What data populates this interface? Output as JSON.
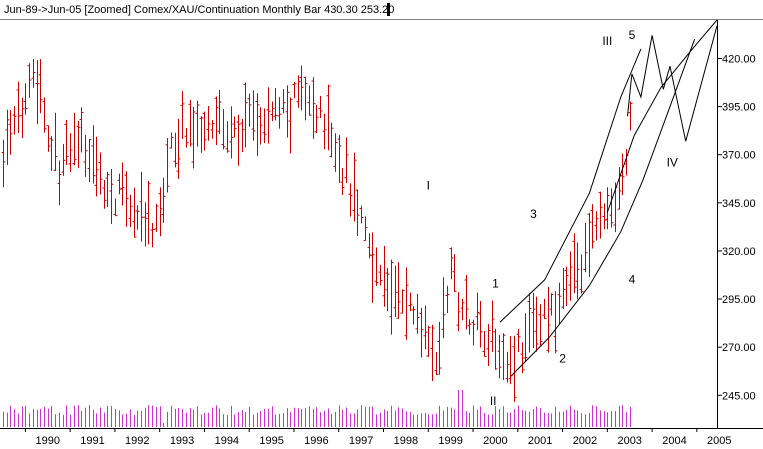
{
  "header": {
    "title": "Jun-89->Jun-05 [Zoomed] Comex/XAU/Continuation Monthly Bar 430.30 253.20"
  },
  "colors": {
    "background": "#ffffff",
    "price_bars": "#cc0000",
    "volume_bars": "#cc33cc",
    "projection_lines": "#000000",
    "axis": "#000000"
  },
  "chart_data": {
    "type": "bar",
    "subtype": "ohlc-monthly",
    "title": "Jun-89->Jun-05 [Zoomed] Comex/XAU/Continuation Monthly Bar 430.30 253.20",
    "x_start": 1989.5,
    "x_end": 2005.5,
    "xlim": [
      1989.5,
      2005.45
    ],
    "ylim": [
      228,
      440
    ],
    "x_ticks": [
      "1990",
      "1991",
      "1992",
      "1993",
      "1994",
      "1995",
      "1996",
      "1997",
      "1998",
      "1999",
      "2000",
      "2001",
      "2002",
      "2003",
      "2004",
      "2005"
    ],
    "y_ticks": [
      "420.00",
      "395.00",
      "370.00",
      "345.00",
      "320.00",
      "295.00",
      "270.00",
      "245.00"
    ],
    "y_tick_values": [
      420,
      395,
      370,
      345,
      320,
      295,
      270,
      245
    ],
    "grid": false,
    "legend": "none",
    "price_anchors": [
      [
        1989.5,
        372
      ],
      [
        1989.9,
        392
      ],
      [
        1990.1,
        418
      ],
      [
        1990.35,
        402
      ],
      [
        1990.6,
        372
      ],
      [
        1990.8,
        362
      ],
      [
        1991.2,
        378
      ],
      [
        1991.6,
        360
      ],
      [
        1991.9,
        350
      ],
      [
        1992.2,
        348
      ],
      [
        1992.5,
        340
      ],
      [
        1992.8,
        330
      ],
      [
        1993.0,
        338
      ],
      [
        1993.25,
        372
      ],
      [
        1993.5,
        385
      ],
      [
        1993.8,
        380
      ],
      [
        1994.1,
        392
      ],
      [
        1994.4,
        385
      ],
      [
        1994.7,
        378
      ],
      [
        1995.0,
        388
      ],
      [
        1995.3,
        384
      ],
      [
        1995.6,
        395
      ],
      [
        1995.9,
        390
      ],
      [
        1996.1,
        404
      ],
      [
        1996.4,
        395
      ],
      [
        1996.7,
        388
      ],
      [
        1997.0,
        370
      ],
      [
        1997.3,
        350
      ],
      [
        1997.6,
        330
      ],
      [
        1997.9,
        308
      ],
      [
        1998.2,
        298
      ],
      [
        1998.5,
        292
      ],
      [
        1998.8,
        285
      ],
      [
        1999.0,
        280
      ],
      [
        1999.2,
        262
      ],
      [
        1999.35,
        290
      ],
      [
        1999.5,
        310
      ],
      [
        1999.7,
        292
      ],
      [
        2000.0,
        285
      ],
      [
        2000.3,
        278
      ],
      [
        2000.6,
        272
      ],
      [
        2000.85,
        262
      ],
      [
        2001.0,
        268
      ],
      [
        2001.2,
        275
      ],
      [
        2001.45,
        285
      ],
      [
        2001.7,
        285
      ],
      [
        2001.9,
        292
      ],
      [
        2002.1,
        303
      ],
      [
        2002.35,
        315
      ],
      [
        2002.6,
        320
      ],
      [
        2002.8,
        340
      ],
      [
        2003.0,
        335
      ],
      [
        2003.15,
        345
      ],
      [
        2003.3,
        355
      ],
      [
        2003.45,
        370
      ],
      [
        2003.5,
        385
      ]
    ],
    "volume_level": "low, roughly uniform with a spike in 1999",
    "annotations": {
      "wave_labels": [
        {
          "text": "III",
          "x": 2003.0,
          "y": 427
        },
        {
          "text": "5",
          "x": 2003.55,
          "y": 430
        },
        {
          "text": "I",
          "x": 1999.0,
          "y": 352
        },
        {
          "text": "3",
          "x": 2001.35,
          "y": 337
        },
        {
          "text": "1",
          "x": 2000.5,
          "y": 301
        },
        {
          "text": "4",
          "x": 2003.55,
          "y": 303
        },
        {
          "text": "IV",
          "x": 2004.45,
          "y": 364
        },
        {
          "text": "2",
          "x": 2002.0,
          "y": 262
        },
        {
          "text": "II",
          "x": 2000.45,
          "y": 240
        }
      ],
      "channel_upper": [
        [
          2000.6,
          283
        ],
        [
          2001.6,
          305
        ],
        [
          2002.6,
          350
        ],
        [
          2003.3,
          400
        ],
        [
          2003.75,
          425
        ]
      ],
      "channel_lower": [
        [
          2000.85,
          255
        ],
        [
          2001.7,
          275
        ],
        [
          2002.6,
          302
        ],
        [
          2003.3,
          330
        ],
        [
          2003.8,
          357
        ],
        [
          2004.4,
          395
        ],
        [
          2004.95,
          430
        ]
      ],
      "channel_outer": [
        [
          2003.0,
          340
        ],
        [
          2003.6,
          380
        ],
        [
          2004.2,
          405
        ],
        [
          2004.9,
          425
        ],
        [
          2005.45,
          440
        ]
      ],
      "zigzag_projection": [
        [
          2003.45,
          390
        ],
        [
          2003.55,
          412
        ],
        [
          2003.75,
          400
        ],
        [
          2004.0,
          432
        ],
        [
          2004.25,
          404
        ],
        [
          2004.4,
          416
        ],
        [
          2004.75,
          377
        ],
        [
          2005.45,
          437
        ]
      ]
    }
  }
}
